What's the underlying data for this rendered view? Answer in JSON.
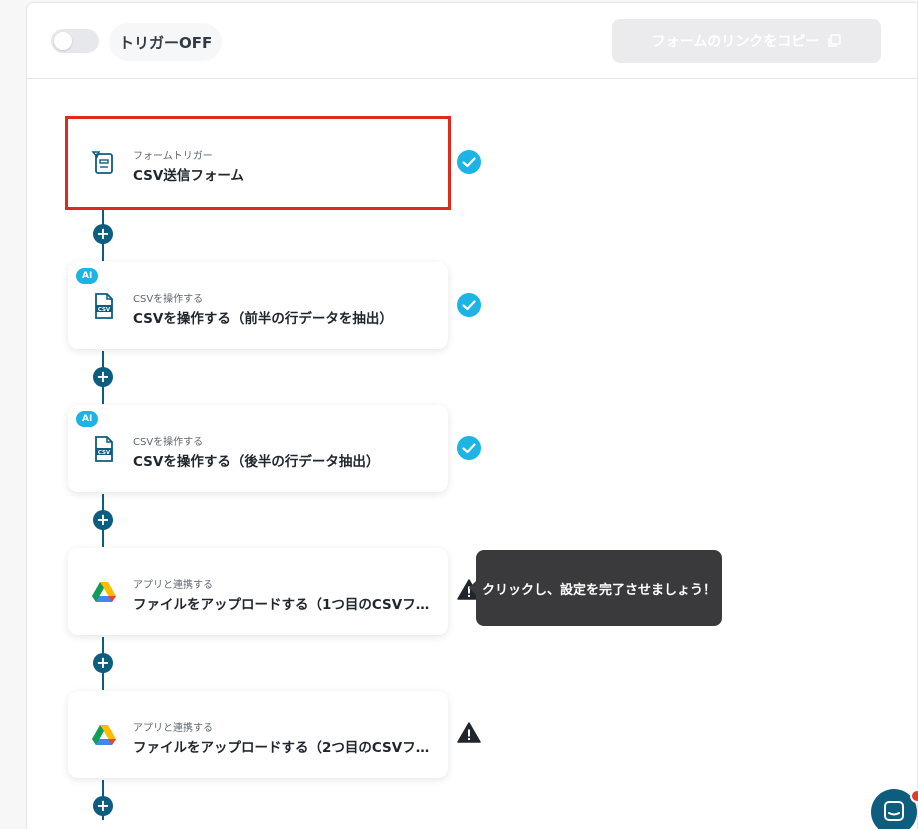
{
  "topbar": {
    "trigger_toggle_state": "off",
    "trigger_label": "トリガーOFF",
    "copy_link_label": "フォームのリンクをコピー"
  },
  "steps": [
    {
      "subtitle": "フォームトリガー",
      "title": "CSV送信フォーム",
      "icon": "form-icon",
      "ai": false,
      "status": "complete"
    },
    {
      "subtitle": "CSVを操作する",
      "title": "CSVを操作する（前半の行データを抽出）",
      "icon": "csv-file-icon",
      "ai": true,
      "status": "complete"
    },
    {
      "subtitle": "CSVを操作する",
      "title": "CSVを操作する（後半の行データ抽出）",
      "icon": "csv-file-icon",
      "ai": true,
      "status": "complete"
    },
    {
      "subtitle": "アプリと連携する",
      "title": "ファイルをアップロードする（1つ目のCSVフ…",
      "icon": "google-drive-icon",
      "ai": false,
      "status": "warning"
    },
    {
      "subtitle": "アプリと連携する",
      "title": "ファイルをアップロードする（2つ目のCSVフ…",
      "icon": "google-drive-icon",
      "ai": false,
      "status": "warning"
    }
  ],
  "ai_badge_label": "AI",
  "add_step_symbol": "+",
  "tooltip_text": "クリックし、設定を完了させましょう！",
  "colors": {
    "accent": "#0d5d7e",
    "check": "#1bb4e4",
    "selected_outline": "#e02a1c",
    "warning": "#1f262e"
  }
}
